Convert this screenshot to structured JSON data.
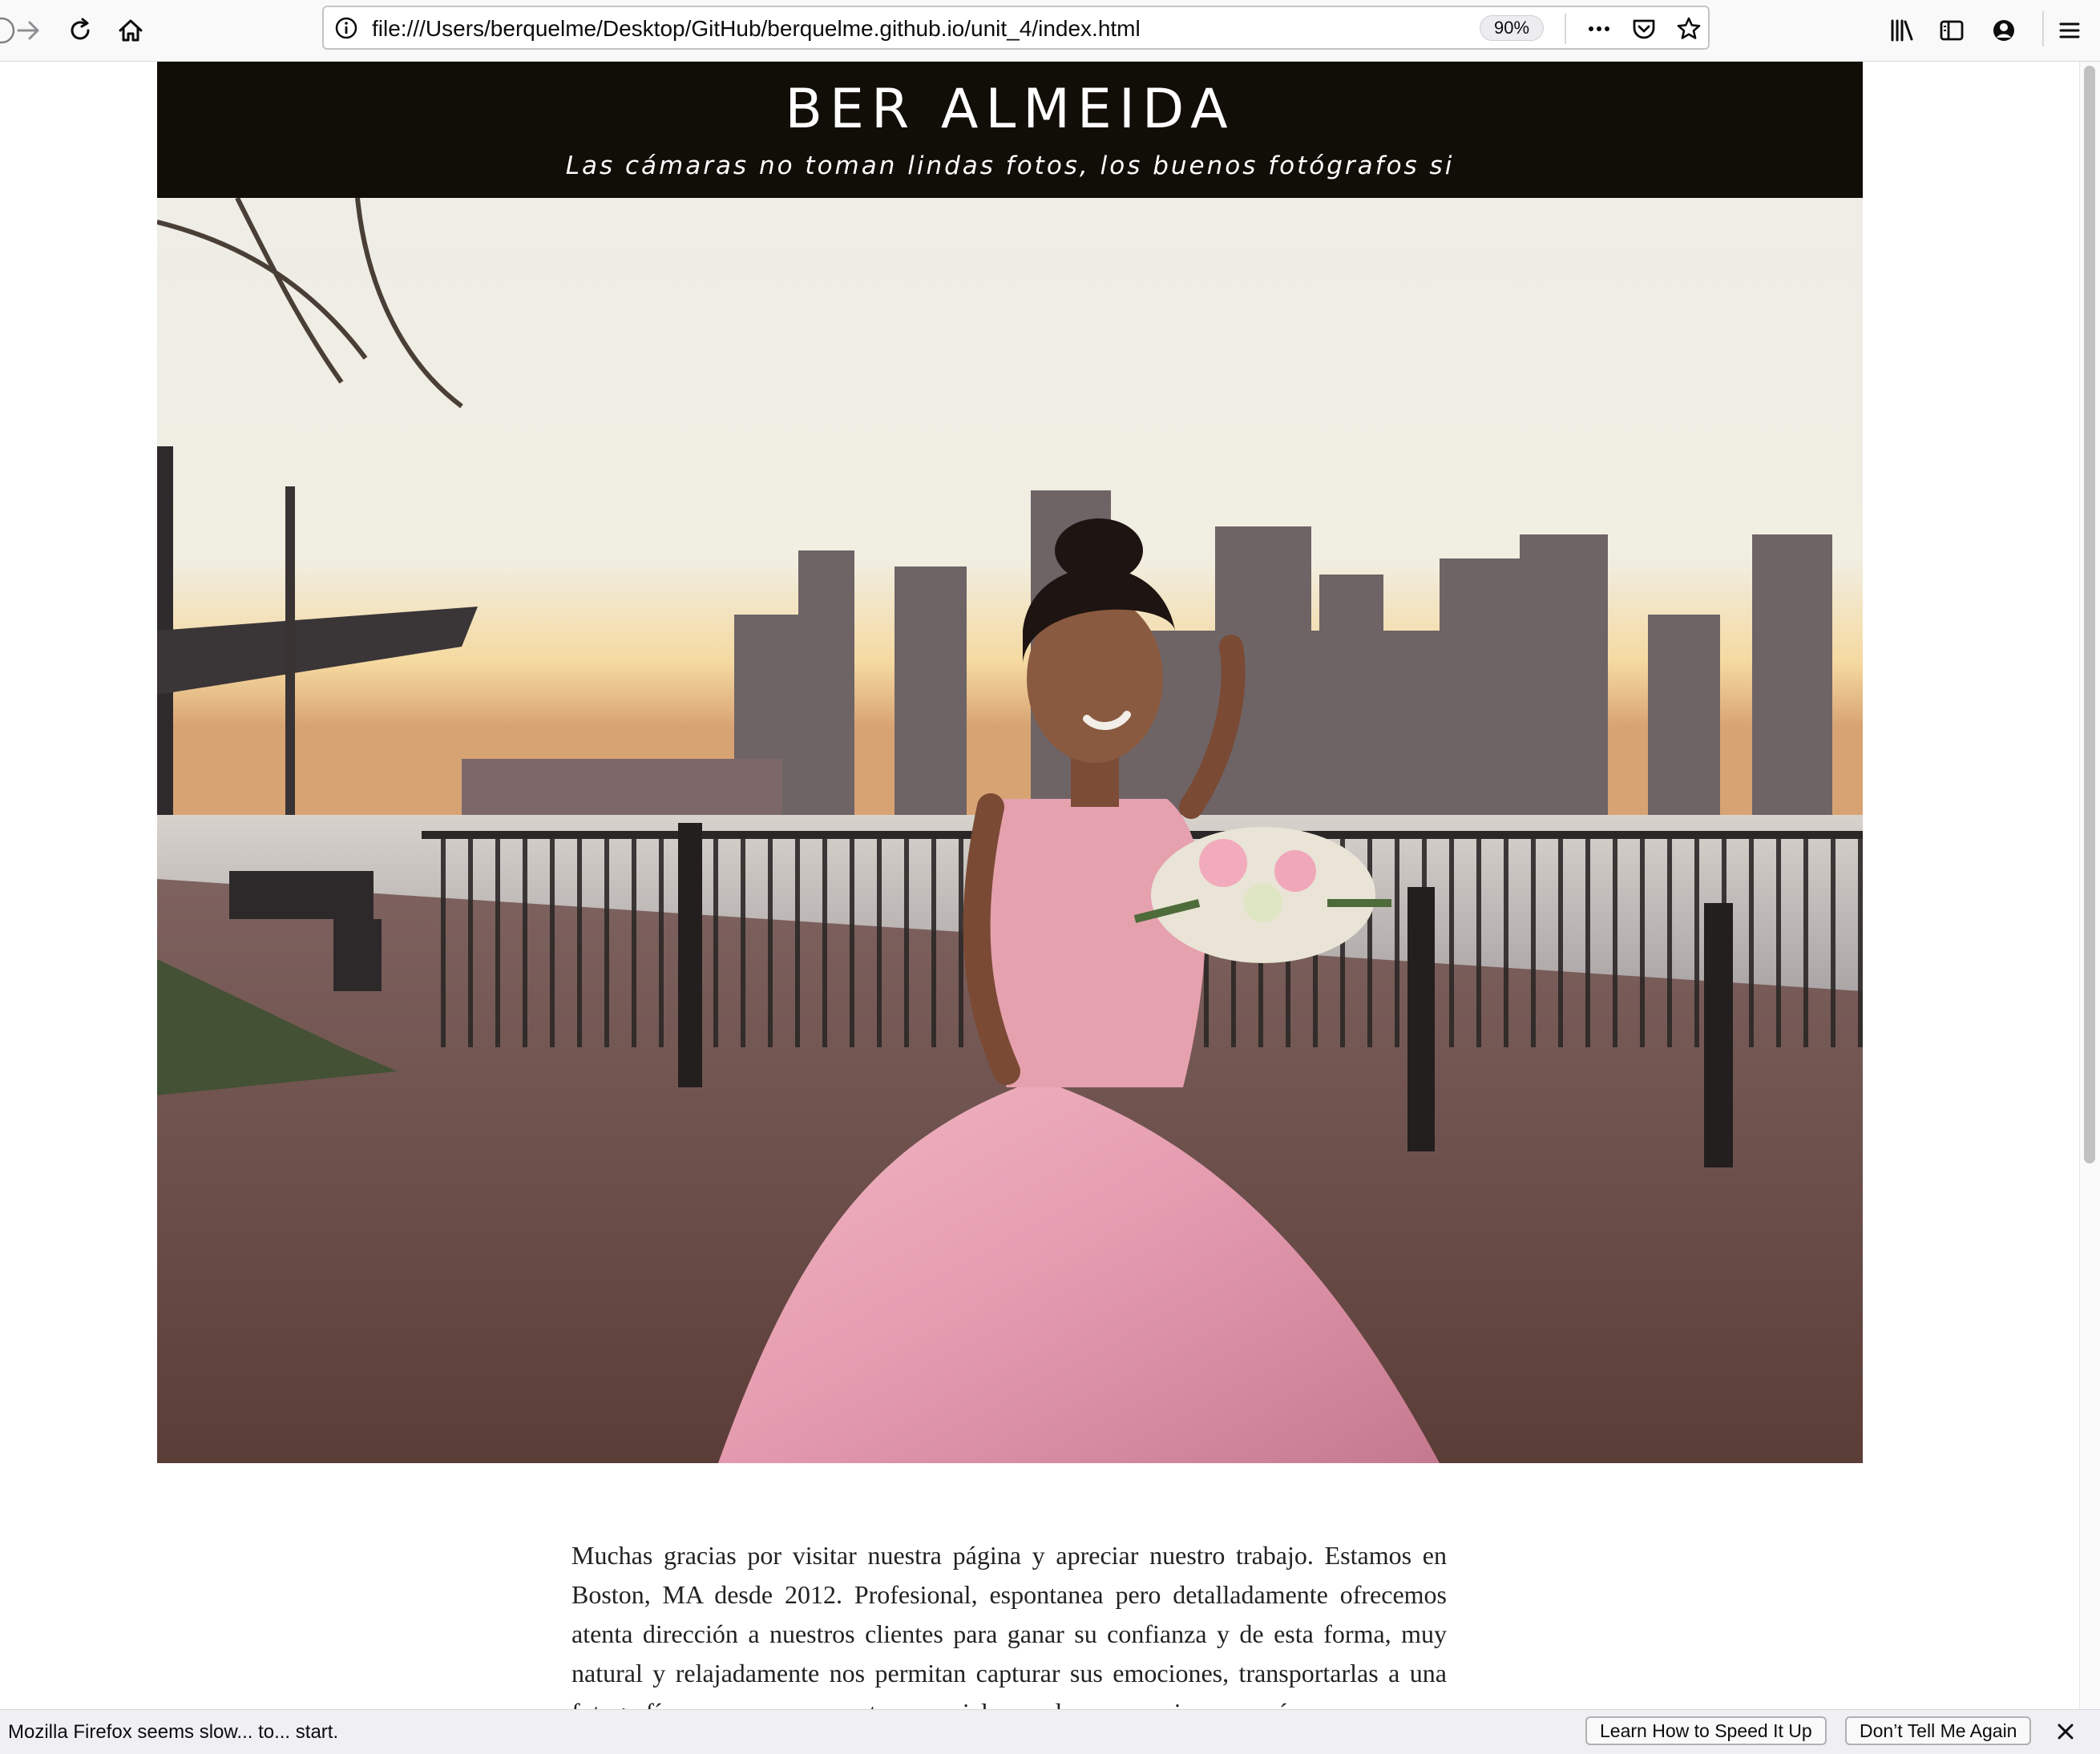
{
  "browser": {
    "url": "file:///Users/berquelme/Desktop/GitHub/berquelme.github.io/unit_4/index.html",
    "zoom": "90%",
    "icons": [
      "back-arrow-icon",
      "forward-arrow-icon",
      "reload-icon",
      "home-icon",
      "info-icon",
      "more-actions-icon",
      "pocket-icon",
      "bookmark-star-icon",
      "library-icon",
      "sidebar-icon",
      "account-icon",
      "hamburger-menu-icon"
    ]
  },
  "site": {
    "title": "BER ALMEIDA",
    "tagline": "Las cámaras no toman lindas fotos, los buenos fotógrafos si",
    "intro": "Muchas gracias por visitar nuestra página y apreciar nuestro trabajo. Estamos en Boston, MA desde 2012. Profesional, espontanea pero detalladamente ofrecemos atenta dirección a nuestros clientes para ganar su confianza y de esta forma, muy natural y relajadamente nos permitan capturar sus emociones, transportarlas a una fotografía y que esos momentos especiales perduren para siempre, así como"
  },
  "notification": {
    "message": "Mozilla Firefox seems slow... to... start.",
    "learn_button": "Learn How to Speed It Up",
    "dismiss_button": "Don’t Tell Me Again"
  },
  "colors": {
    "header_bg": "#110e08",
    "dress_pink": "#e8a0b2",
    "sky": "#f3efe4"
  }
}
